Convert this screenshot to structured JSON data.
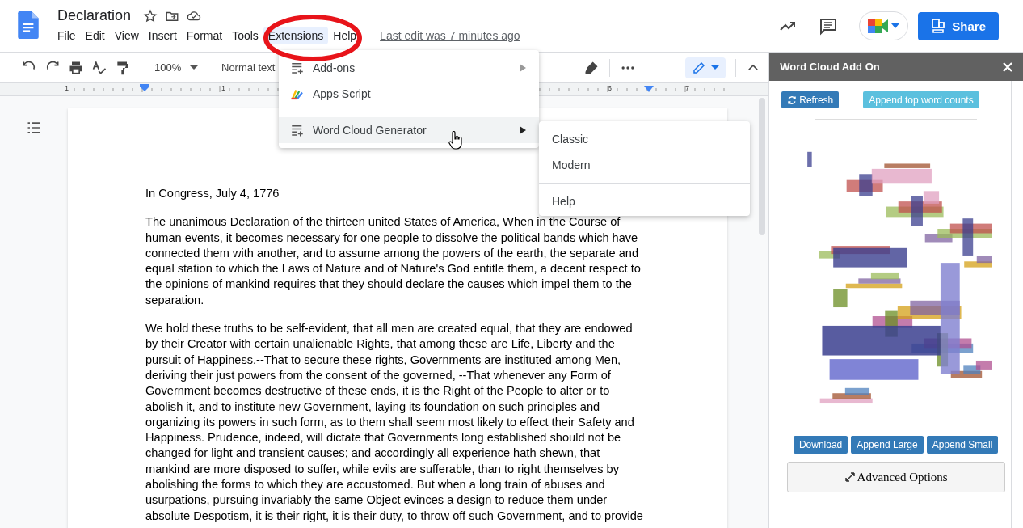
{
  "document": {
    "title": "Declaration",
    "last_edit": "Last edit was 7 minutes ago"
  },
  "menu_bar": [
    {
      "label": "File",
      "selected": false
    },
    {
      "label": "Edit",
      "selected": false
    },
    {
      "label": "View",
      "selected": false
    },
    {
      "label": "Insert",
      "selected": false
    },
    {
      "label": "Format",
      "selected": false
    },
    {
      "label": "Tools",
      "selected": false
    },
    {
      "label": "Extensions",
      "selected": true
    },
    {
      "label": "Help",
      "selected": false
    }
  ],
  "share_button": "Share",
  "toolbar": {
    "zoom": "100%",
    "style": "Normal text"
  },
  "ruler": [
    "1",
    "1",
    "6",
    "7"
  ],
  "extensions_menu": [
    {
      "label": "Add-ons",
      "kind": "addons",
      "selected": false
    },
    {
      "label": "Apps Script",
      "kind": "script",
      "selected": false
    },
    {
      "label": "Word Cloud Generator",
      "kind": "addons",
      "selected": true
    }
  ],
  "submenu": [
    "Classic",
    "Modern",
    "Help"
  ],
  "paragraphs": [
    "In Congress, July 4, 1776",
    "The unanimous Declaration of the thirteen united States of America, When in the Course of human events, it becomes necessary for one people to dissolve the political bands which have connected them with another, and to assume among the powers of the earth, the separate and equal station to which the Laws of Nature and of Nature's God entitle them, a decent respect to the opinions of mankind requires that they should declare the causes which impel them to the separation.",
    "We hold these truths to be self-evident, that all men are created equal, that they are endowed by their Creator with certain unalienable Rights, that among these are Life, Liberty and the pursuit of Happiness.--That to secure these rights, Governments are instituted among Men, deriving their just powers from the consent of the governed, --That whenever any Form of Government becomes destructive of these ends, it is the Right of the People to alter or to abolish it, and to institute new Government, laying its foundation on such principles and organizing its powers in such form, as to them shall seem most likely to effect their Safety and Happiness. Prudence, indeed, will dictate that Governments long established should not be changed for light and transient causes; and accordingly all experience hath shewn, that mankind are more disposed to suffer, while evils are sufferable, than to right themselves by abolishing the forms to which they are accustomed. But when a long train of abuses and usurpations, pursuing invariably the same Object evinces a design to reduce them under absolute Despotism, it is their right, it is their duty, to throw off such Government, and to provide"
  ],
  "sidebar": {
    "title": "Word Cloud Add On",
    "refresh": "Refresh",
    "append_counts": "Append top word counts",
    "word_cloud": {
      "kind": "picture"
    },
    "actions": [
      "Download",
      "Append Large",
      "Append Small"
    ],
    "advanced": "Advanced Options"
  }
}
